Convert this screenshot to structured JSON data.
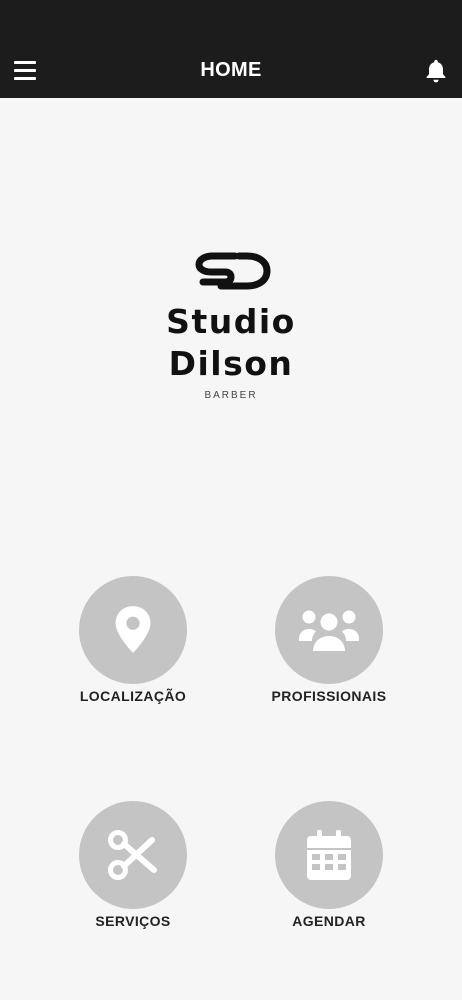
{
  "header": {
    "title": "HOME",
    "menu_icon": "hamburger-menu-icon",
    "notification_icon": "bell-icon",
    "background": "#1c1c1c"
  },
  "logo": {
    "line1": "Studio",
    "line2": "Dilson",
    "subtitle": "BARBER"
  },
  "menu": {
    "items": [
      {
        "label": "LOCALIZAÇÃO",
        "icon": "map-pin-icon"
      },
      {
        "label": "PROFISSIONAIS",
        "icon": "people-group-icon"
      },
      {
        "label": "SERVIÇOS",
        "icon": "scissors-icon"
      },
      {
        "label": "AGENDAR",
        "icon": "calendar-icon"
      }
    ],
    "circle_color": "#c4c4c4"
  }
}
